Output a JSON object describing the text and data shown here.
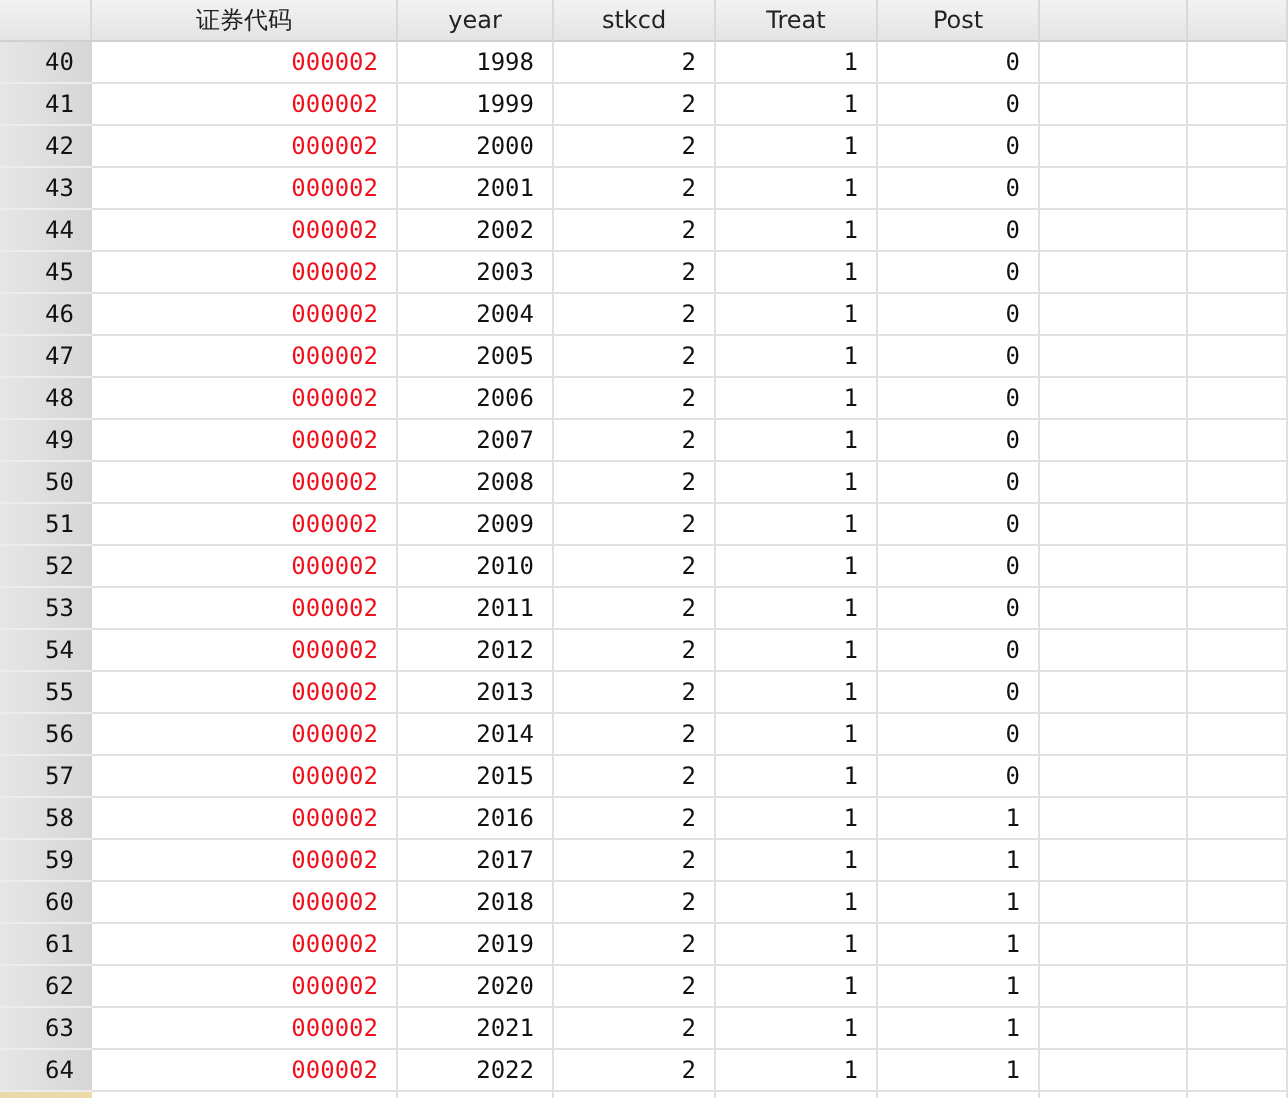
{
  "columns": [
    {
      "name": "证券代码",
      "kind": "string"
    },
    {
      "name": "year",
      "kind": "numeric"
    },
    {
      "name": "stkcd",
      "kind": "numeric"
    },
    {
      "name": "Treat",
      "kind": "numeric"
    },
    {
      "name": "Post",
      "kind": "numeric"
    }
  ],
  "rows": [
    {
      "number": "40",
      "cells": [
        "000002",
        "1998",
        "2",
        "1",
        "0"
      ]
    },
    {
      "number": "41",
      "cells": [
        "000002",
        "1999",
        "2",
        "1",
        "0"
      ]
    },
    {
      "number": "42",
      "cells": [
        "000002",
        "2000",
        "2",
        "1",
        "0"
      ]
    },
    {
      "number": "43",
      "cells": [
        "000002",
        "2001",
        "2",
        "1",
        "0"
      ]
    },
    {
      "number": "44",
      "cells": [
        "000002",
        "2002",
        "2",
        "1",
        "0"
      ]
    },
    {
      "number": "45",
      "cells": [
        "000002",
        "2003",
        "2",
        "1",
        "0"
      ]
    },
    {
      "number": "46",
      "cells": [
        "000002",
        "2004",
        "2",
        "1",
        "0"
      ]
    },
    {
      "number": "47",
      "cells": [
        "000002",
        "2005",
        "2",
        "1",
        "0"
      ]
    },
    {
      "number": "48",
      "cells": [
        "000002",
        "2006",
        "2",
        "1",
        "0"
      ]
    },
    {
      "number": "49",
      "cells": [
        "000002",
        "2007",
        "2",
        "1",
        "0"
      ]
    },
    {
      "number": "50",
      "cells": [
        "000002",
        "2008",
        "2",
        "1",
        "0"
      ]
    },
    {
      "number": "51",
      "cells": [
        "000002",
        "2009",
        "2",
        "1",
        "0"
      ]
    },
    {
      "number": "52",
      "cells": [
        "000002",
        "2010",
        "2",
        "1",
        "0"
      ]
    },
    {
      "number": "53",
      "cells": [
        "000002",
        "2011",
        "2",
        "1",
        "0"
      ]
    },
    {
      "number": "54",
      "cells": [
        "000002",
        "2012",
        "2",
        "1",
        "0"
      ]
    },
    {
      "number": "55",
      "cells": [
        "000002",
        "2013",
        "2",
        "1",
        "0"
      ]
    },
    {
      "number": "56",
      "cells": [
        "000002",
        "2014",
        "2",
        "1",
        "0"
      ]
    },
    {
      "number": "57",
      "cells": [
        "000002",
        "2015",
        "2",
        "1",
        "0"
      ]
    },
    {
      "number": "58",
      "cells": [
        "000002",
        "2016",
        "2",
        "1",
        "1"
      ]
    },
    {
      "number": "59",
      "cells": [
        "000002",
        "2017",
        "2",
        "1",
        "1"
      ]
    },
    {
      "number": "60",
      "cells": [
        "000002",
        "2018",
        "2",
        "1",
        "1"
      ]
    },
    {
      "number": "61",
      "cells": [
        "000002",
        "2019",
        "2",
        "1",
        "1"
      ]
    },
    {
      "number": "62",
      "cells": [
        "000002",
        "2020",
        "2",
        "1",
        "1"
      ]
    },
    {
      "number": "63",
      "cells": [
        "000002",
        "2021",
        "2",
        "1",
        "1"
      ]
    },
    {
      "number": "64",
      "cells": [
        "000002",
        "2022",
        "2",
        "1",
        "1"
      ]
    }
  ]
}
